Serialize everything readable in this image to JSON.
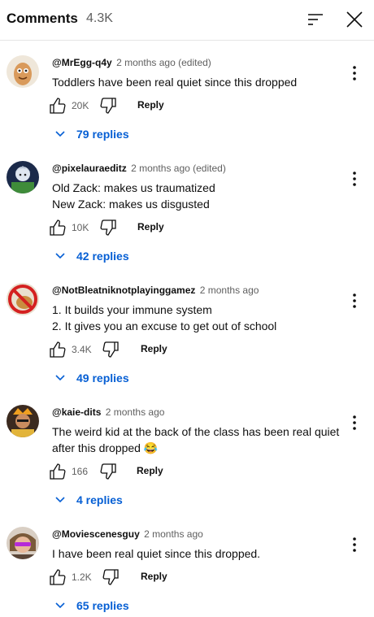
{
  "header": {
    "title": "Comments",
    "count": "4.3K",
    "sort_icon": "sort-icon",
    "close_icon": "close-icon"
  },
  "comments": [
    {
      "author": "@MrEgg-q4y",
      "time": "2 months ago (edited)",
      "lines": [
        "Toddlers have been real quiet since this dropped"
      ],
      "likes": "20K",
      "reply_label": "Reply",
      "replies": "79 replies"
    },
    {
      "author": "@pixelauraeditz",
      "time": "2 months ago (edited)",
      "lines": [
        "Old Zack: makes us traumatized",
        "New Zack: makes us disgusted"
      ],
      "likes": "10K",
      "reply_label": "Reply",
      "replies": "42 replies"
    },
    {
      "author": "@NotBleatniknotplayinggamez",
      "time": "2 months ago",
      "lines": [
        "1. It builds your immune system",
        "2. It gives you an excuse to get out of school"
      ],
      "likes": "3.4K",
      "reply_label": "Reply",
      "replies": "49 replies"
    },
    {
      "author": "@kaie-dits",
      "time": "2 months ago",
      "lines": [
        "The weird kid at the back of the class has been real quiet",
        "after this dropped 😂"
      ],
      "likes": "166",
      "reply_label": "Reply",
      "replies": "4 replies"
    },
    {
      "author": "@Moviescenesguy",
      "time": "2 months ago",
      "lines": [
        "I have been real quiet since this dropped."
      ],
      "likes": "1.2K",
      "reply_label": "Reply",
      "replies": "65 replies"
    }
  ],
  "colors": {
    "link": "#065fd4",
    "secondary_text": "#606060",
    "primary_text": "#0f0f0f"
  }
}
